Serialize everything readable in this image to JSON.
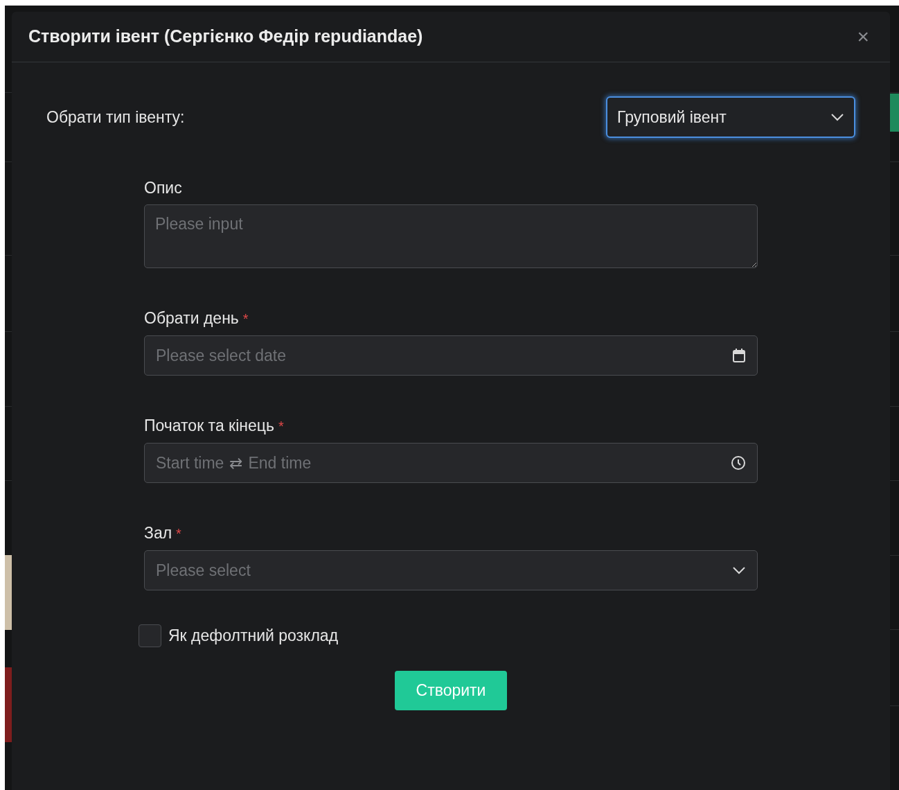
{
  "modal": {
    "title": "Створити івент (Сергієнко Федір repudiandae)",
    "close": "×"
  },
  "event_type": {
    "label": "Обрати тип івенту:",
    "value": "Груповий івент",
    "focused": true
  },
  "fields": [
    {
      "kind": "textarea",
      "label": "Опис",
      "placeholder": "Please input"
    },
    {
      "kind": "date",
      "label": "Обрати день",
      "required_mark": "*",
      "placeholder": "Please select date"
    },
    {
      "kind": "timerange",
      "label": "Початок та кінець",
      "required_mark": "*",
      "start_placeholder": "Start time",
      "separator": "⇄",
      "end_placeholder": "End time"
    },
    {
      "kind": "select",
      "label": "Зал",
      "required_mark": "*",
      "placeholder": "Please select"
    }
  ],
  "default_schedule": {
    "label": "Як дефолтний розклад",
    "checked": false
  },
  "submit": "Створити"
}
